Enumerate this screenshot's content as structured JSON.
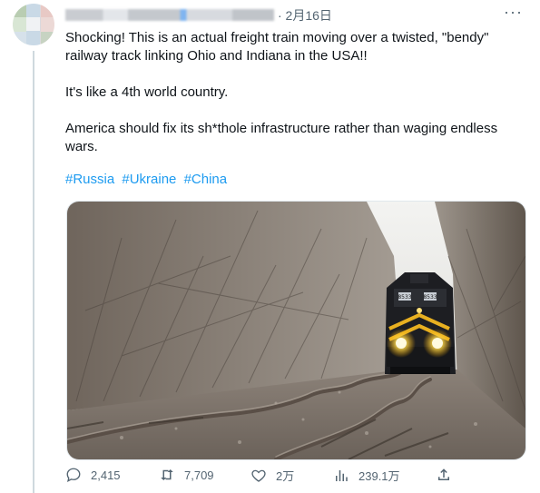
{
  "header": {
    "date": "· 2月16日",
    "more_icon": "more-horizontal-icon"
  },
  "tweet": {
    "paragraphs": [
      "Shocking! This is an actual freight train moving over a twisted, \"bendy\" railway track linking Ohio and Indiana in the USA!!",
      "It's like a 4th world country.",
      "America should fix its sh*thole infrastructure rather than waging endless wars."
    ],
    "hashtags": [
      "#Russia",
      "#Ukraine",
      "#China"
    ]
  },
  "media": {
    "locomotive_numbers": [
      "8533",
      "8533"
    ]
  },
  "actions": {
    "replies": "2,415",
    "retweets": "7,709",
    "likes": "2万",
    "views": "239.1万"
  },
  "colors": {
    "link": "#1d9bf0",
    "secondary_text": "#536471"
  }
}
